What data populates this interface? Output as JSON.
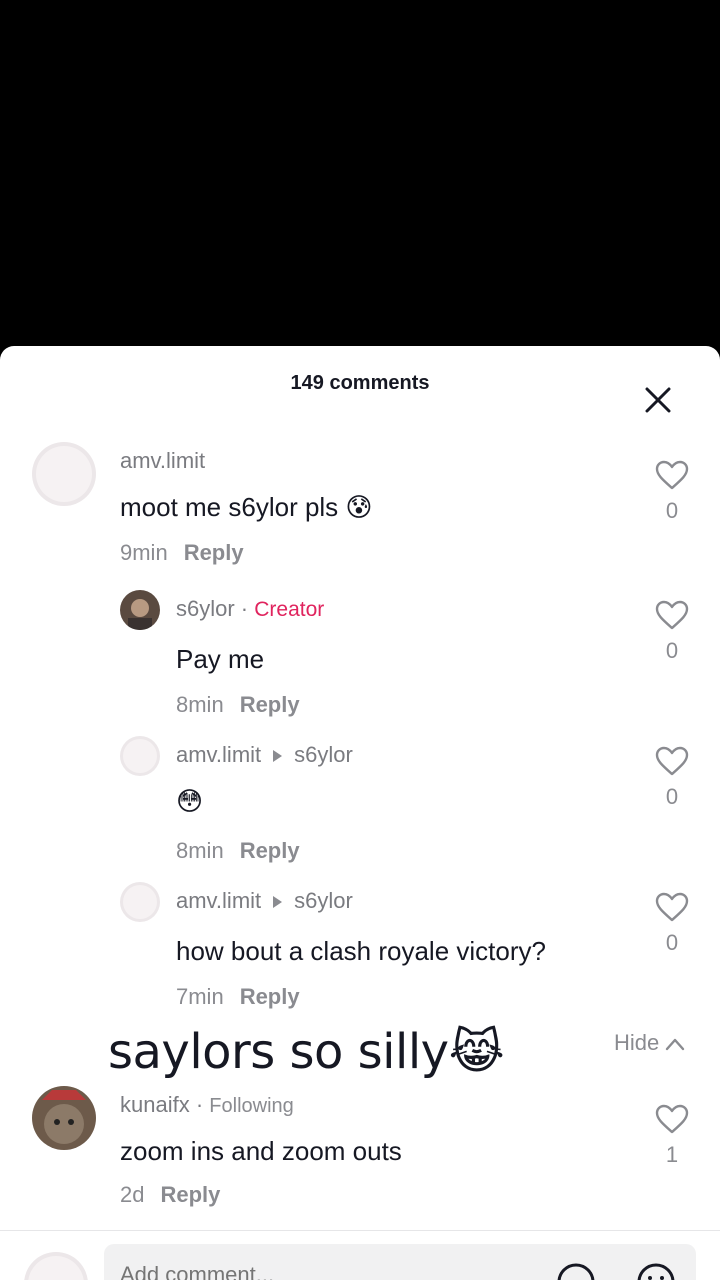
{
  "sheet": {
    "title": "149 comments",
    "hide_label": "Hide",
    "caption": "saylors so silly😹",
    "input_placeholder": "Add comment..."
  },
  "comments": [
    {
      "username": "amv.limit",
      "text": "moot me s6ylor pls 😰",
      "time": "9min",
      "reply": "Reply",
      "likes": "0"
    },
    {
      "username": "s6ylor",
      "tag": "Creator",
      "text": "Pay me",
      "time": "8min",
      "reply": "Reply",
      "likes": "0"
    },
    {
      "username": "amv.limit",
      "reply_to": "s6ylor",
      "text": "😳",
      "time": "8min",
      "reply": "Reply",
      "likes": "0"
    },
    {
      "username": "amv.limit",
      "reply_to": "s6ylor",
      "text": "how bout a clash royale victory?",
      "time": "7min",
      "reply": "Reply",
      "likes": "0"
    },
    {
      "username": "kunaifx",
      "tag": "Following",
      "text": "zoom ins and zoom outs",
      "time": "2d",
      "reply": "Reply",
      "likes": "1"
    }
  ]
}
